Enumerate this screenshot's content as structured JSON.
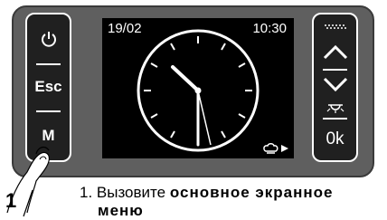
{
  "left_buttons": {
    "power_icon": "power-icon",
    "esc_label": "Esc",
    "menu_label": "M"
  },
  "right_buttons": {
    "top_icon": "dotted-line-icon",
    "up_icon": "chevron-up-icon",
    "down_icon": "chevron-down-icon",
    "light_icon": "light-icon",
    "ok_label": "0k"
  },
  "display": {
    "date": "19/02",
    "time": "10:30",
    "clock_time": "10:30",
    "indicator_icon": "chef-hat-play-icon"
  },
  "instruction": {
    "step_number": "1",
    "prefix": "1. Вызовите",
    "emphasis_line1": "основное экранное",
    "emphasis_line2": "меню"
  },
  "colors": {
    "panel": "#5f5f5f",
    "strip": "#202020",
    "screen": "#000000",
    "foreground": "#ffffff"
  }
}
